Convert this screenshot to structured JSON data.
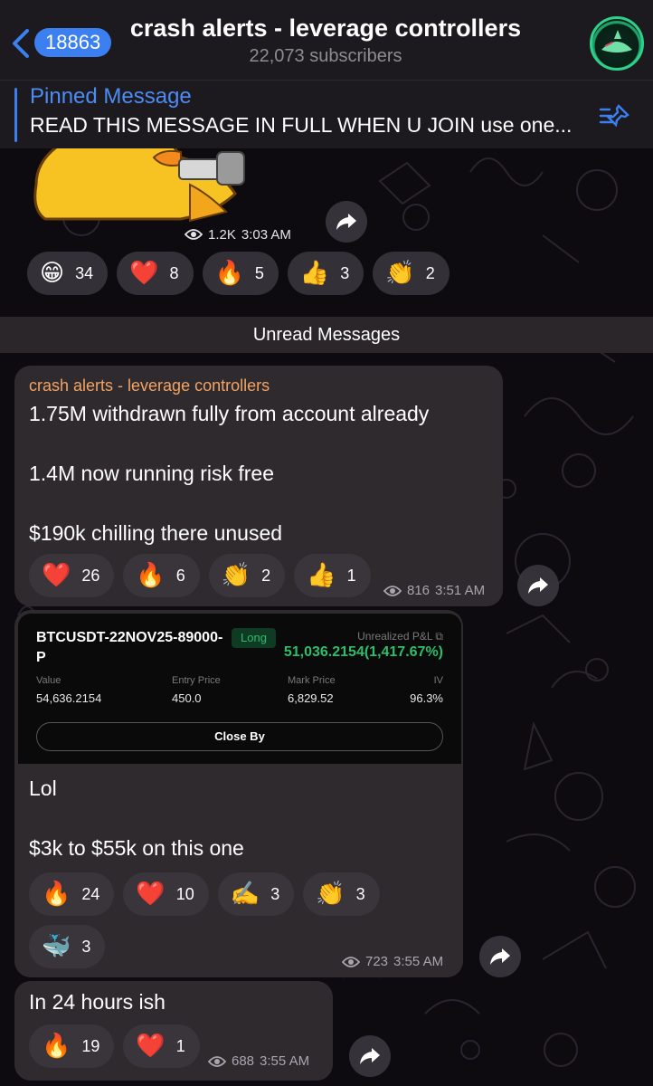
{
  "header": {
    "back_count": "18863",
    "title": "crash alerts - leverage controllers",
    "subtitle": "22,073 subscribers"
  },
  "pinned": {
    "title": "Pinned Message",
    "text": "READ THIS MESSAGE IN FULL WHEN U JOIN use one..."
  },
  "sticker_message": {
    "views": "1.2K",
    "time": "3:03 AM",
    "reactions": [
      {
        "emoji": "😁",
        "count": "34"
      },
      {
        "emoji": "❤️",
        "count": "8"
      },
      {
        "emoji": "🔥",
        "count": "5"
      },
      {
        "emoji": "👍",
        "count": "3"
      },
      {
        "emoji": "👏",
        "count": "2"
      }
    ]
  },
  "unread_label": "Unread Messages",
  "message1": {
    "sender": "crash alerts - leverage controllers",
    "lines": [
      "1.75M withdrawn fully from account already",
      "1.4M now running risk free",
      "$190k chilling there unused"
    ],
    "reactions": [
      {
        "emoji": "❤️",
        "count": "26"
      },
      {
        "emoji": "🔥",
        "count": "6"
      },
      {
        "emoji": "👏",
        "count": "2"
      },
      {
        "emoji": "👍",
        "count": "1"
      }
    ],
    "views": "816",
    "time": "3:51 AM"
  },
  "message2": {
    "card": {
      "symbol": "BTCUSDT-22NOV25-89000-P",
      "side": "Long",
      "pnl_label": "Unrealized P&L",
      "pnl": "51,036.2154(1,417.67%)",
      "columns": [
        {
          "label": "Value",
          "value": "54,636.2154"
        },
        {
          "label": "Entry Price",
          "value": "450.0"
        },
        {
          "label": "Mark Price",
          "value": "6,829.52"
        },
        {
          "label": "IV",
          "value": "96.3%"
        }
      ],
      "close_label": "Close By"
    },
    "lines": [
      "Lol",
      "$3k to $55k on this one"
    ],
    "reactions": [
      {
        "emoji": "🔥",
        "count": "24"
      },
      {
        "emoji": "❤️",
        "count": "10"
      },
      {
        "emoji": "✍️",
        "count": "3"
      },
      {
        "emoji": "👏",
        "count": "3"
      },
      {
        "emoji": "🐳",
        "count": "3"
      }
    ],
    "views": "723",
    "time": "3:55 AM"
  },
  "message3": {
    "text": "In 24 hours ish",
    "reactions": [
      {
        "emoji": "🔥",
        "count": "19"
      },
      {
        "emoji": "❤️",
        "count": "1"
      }
    ],
    "views": "688",
    "time": "3:55 AM"
  },
  "colors": {
    "accent": "#3b7ff0",
    "sender": "#f2a365",
    "pnl_green": "#2ebd6a",
    "bubble": "#2e2a2e"
  }
}
